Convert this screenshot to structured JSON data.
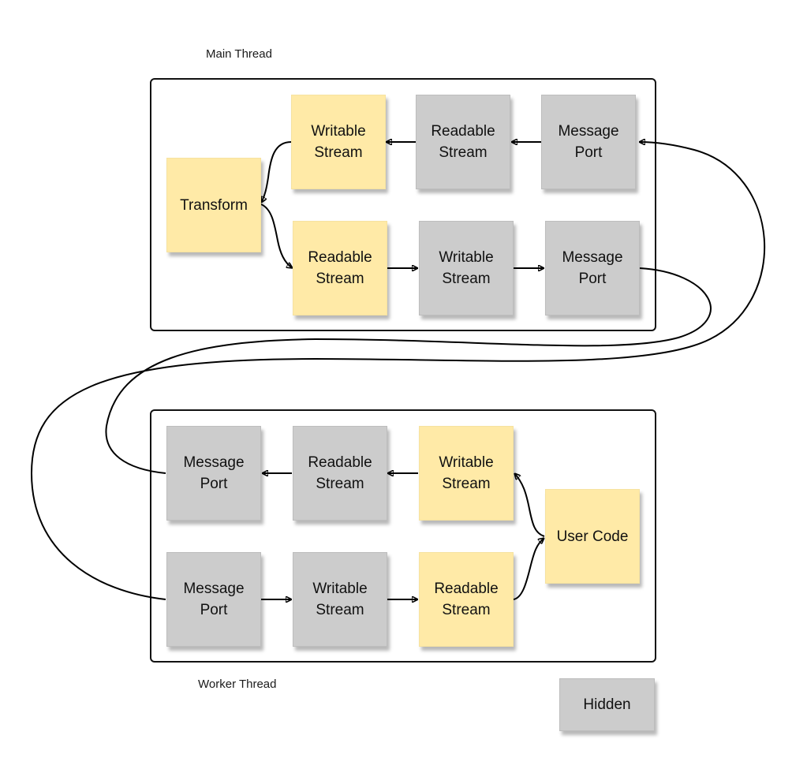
{
  "main_thread": {
    "label": "Main Thread",
    "nodes": {
      "writable_stream": "Writable\nStream",
      "readable_stream_in": "Readable\nStream",
      "message_port_in": "Message\nPort",
      "transform": "Transform",
      "readable_stream_out": "Readable\nStream",
      "writable_stream_out": "Writable\nStream",
      "message_port_out": "Message\nPort"
    }
  },
  "worker_thread": {
    "label": "Worker Thread",
    "nodes": {
      "message_port_out": "Message\nPort",
      "readable_stream_out": "Readable\nStream",
      "writable_stream_in": "Writable\nStream",
      "user_code": "User Code",
      "message_port_in": "Message\nPort",
      "writable_stream": "Writable\nStream",
      "readable_stream": "Readable\nStream"
    }
  },
  "legend": {
    "hidden": "Hidden"
  },
  "colors": {
    "hidden_node": "#cccccc",
    "visible_node": "#ffeaa7",
    "edge": "#000000"
  }
}
